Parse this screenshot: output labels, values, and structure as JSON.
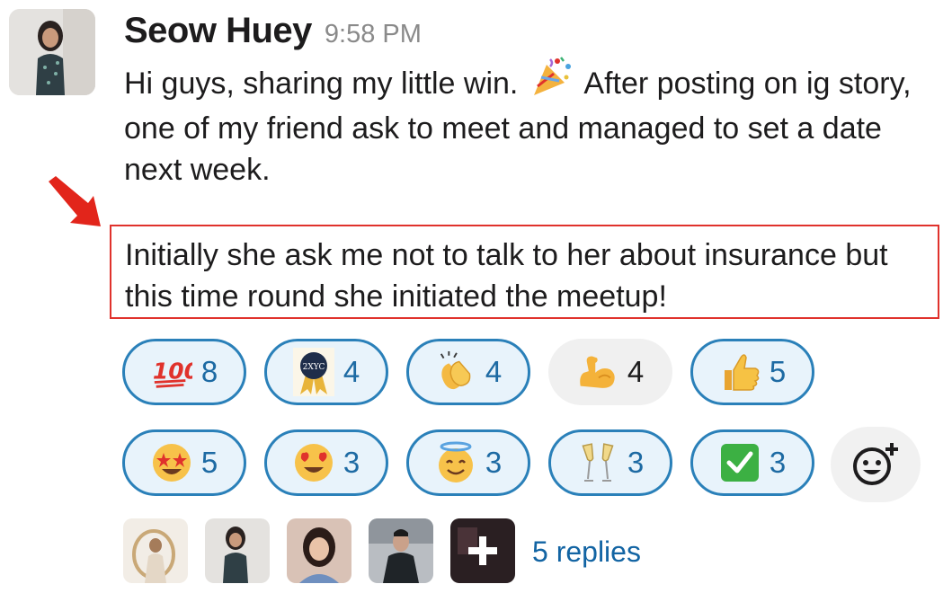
{
  "message": {
    "author": "Seow Huey",
    "time": "9:58 PM",
    "text_before_emoji": "Hi guys, sharing my little win.",
    "text_after_emoji": "After posting on ig story, one of my friend ask to meet and managed to set a date next week.",
    "highlighted_text": "Initially she ask me not to talk to her about insurance but this time round she initiated the meetup!"
  },
  "reactions": [
    {
      "icon": "hundred-points-icon",
      "count": "8"
    },
    {
      "icon": "award-ribbon-icon",
      "badge_text": "2XYC",
      "count": "4"
    },
    {
      "icon": "clapping-hands-icon",
      "count": "4"
    },
    {
      "icon": "flexed-biceps-icon",
      "count": "4"
    },
    {
      "icon": "thumbs-up-icon",
      "count": "5"
    },
    {
      "icon": "star-struck-icon",
      "count": "5"
    },
    {
      "icon": "heart-eyes-icon",
      "count": "3"
    },
    {
      "icon": "halo-smile-icon",
      "count": "3"
    },
    {
      "icon": "champagne-glasses-icon",
      "count": "3"
    },
    {
      "icon": "check-mark-icon",
      "count": "3"
    }
  ],
  "thread": {
    "replies_label": "5 replies"
  },
  "colors": {
    "accent": "#1264a3",
    "highlight_border": "#e0322c"
  }
}
